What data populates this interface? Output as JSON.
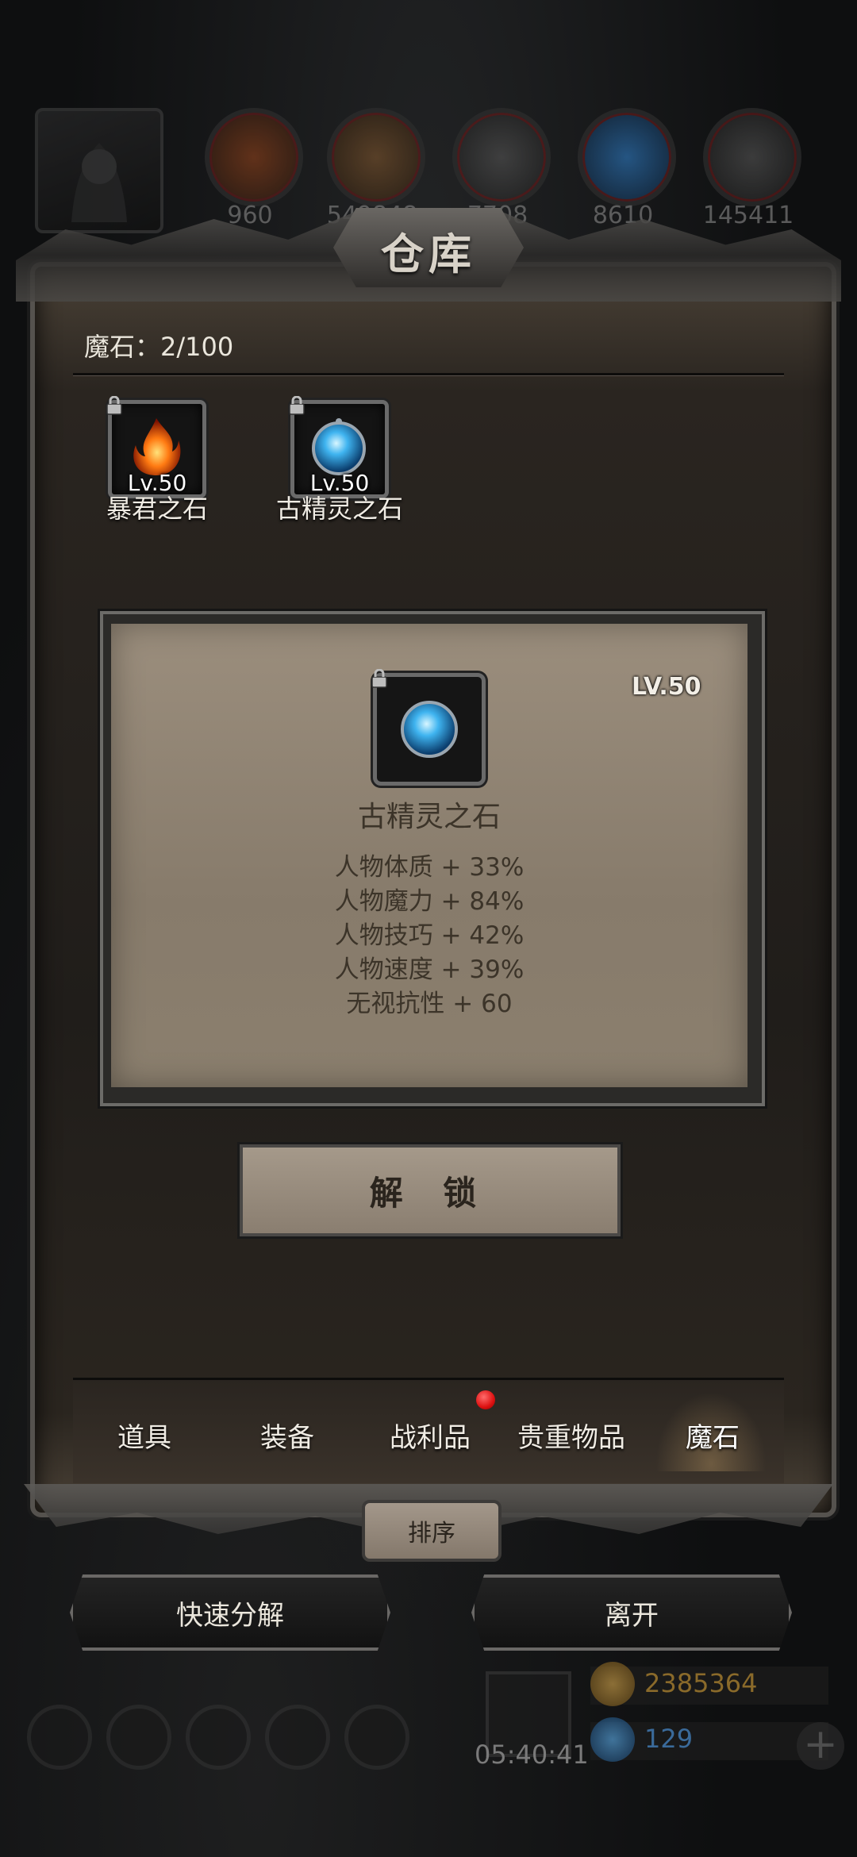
{
  "window": {
    "title": "仓库"
  },
  "top_bar": {
    "resources": [
      {
        "icon": "meat-icon",
        "value": "960"
      },
      {
        "icon": "wood-icon",
        "value": "549848"
      },
      {
        "icon": "iron-icon",
        "value": "7708"
      },
      {
        "icon": "crystal-icon",
        "value": "8610"
      },
      {
        "icon": "stone-icon",
        "value": "145411"
      }
    ]
  },
  "warehouse": {
    "count_label": "魔石：2/100",
    "items": [
      {
        "name": "暴君之石",
        "level": "Lv.50",
        "icon": "fire-stone-icon",
        "locked": true
      },
      {
        "name": "古精灵之石",
        "level": "Lv.50",
        "icon": "blue-orb-icon",
        "locked": true
      }
    ]
  },
  "detail": {
    "level": "LV.50",
    "name": "古精灵之石",
    "stats": [
      "人物体质 + 33%",
      "人物魔力 + 84%",
      "人物技巧 + 42%",
      "人物速度 + 39%",
      "无视抗性 + 60"
    ],
    "unlock_label": "解 锁"
  },
  "tabs": [
    {
      "label": "道具"
    },
    {
      "label": "装备"
    },
    {
      "label": "战利品",
      "notification": true
    },
    {
      "label": "贵重物品"
    },
    {
      "label": "魔石",
      "active": true
    }
  ],
  "sort_label": "排序",
  "actions": {
    "quick_decompose": "快速分解",
    "leave": "离开"
  },
  "hud": {
    "timer": "05:40:41",
    "gold": "2385364",
    "gems": "129"
  },
  "colors": {
    "card_bg": "#8f8373",
    "card_text": "#3c3429",
    "panel_bg": "#201d1a",
    "notify_red": "#dd1111"
  }
}
